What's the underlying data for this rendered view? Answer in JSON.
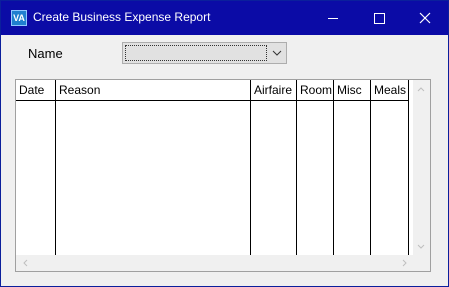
{
  "window": {
    "title": "Create Business Expense Report",
    "icon": "VA"
  },
  "form": {
    "name_label": "Name",
    "name_value": ""
  },
  "grid": {
    "columns": [
      "Date",
      "Reason",
      "Airfaire",
      "Room",
      "Misc",
      "Meals"
    ],
    "rows": []
  },
  "colors": {
    "titlebar": "#0b0ba6",
    "window_bg": "#f0f0f0"
  }
}
